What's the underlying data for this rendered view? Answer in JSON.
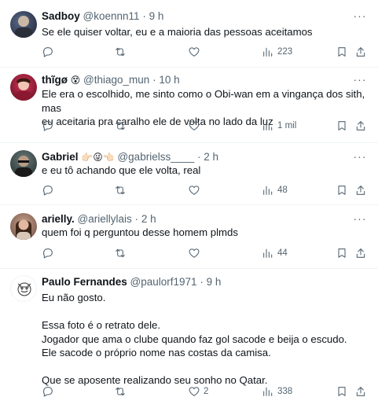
{
  "colors": {
    "text": "#0f1419",
    "secondary": "#536471",
    "divider": "#eff3f4"
  },
  "icons": {
    "reply": "reply-icon",
    "retweet": "retweet-icon",
    "like": "like-icon",
    "views": "views-icon",
    "bookmark": "bookmark-icon",
    "share": "share-icon",
    "more": "more-icon"
  },
  "tweets": [
    {
      "name": "Sadboy",
      "emoji": "",
      "handle": "@koennn11",
      "sep": "·",
      "time": "9 h",
      "lines": [
        "Se ele quiser voltar, eu e a maioria das pessoas aceitamos"
      ],
      "replies": "",
      "retweets": "",
      "likes": "",
      "views": "223"
    },
    {
      "name": "thĩgø",
      "emoji": "😵",
      "handle": "@thiago_mun",
      "sep": "·",
      "time": "10 h",
      "lines": [
        "Ele era o escolhido, me sinto como o Obi-wan em a vingança dos sith, mas",
        "eu aceitaria pra caralho ele de volta no lado da luz"
      ],
      "replies": "",
      "retweets": "",
      "likes": "",
      "views": "1 mil"
    },
    {
      "name": "Gabriel",
      "emoji": "👉🏻😜👈🏻",
      "handle": "@gabrielss____",
      "sep": "·",
      "time": "2 h",
      "lines": [
        "e eu tô achando que ele volta, real"
      ],
      "replies": "",
      "retweets": "",
      "likes": "",
      "views": "48"
    },
    {
      "name": "arielly.",
      "emoji": "",
      "handle": "@ariellylais",
      "sep": "·",
      "time": "2 h",
      "lines": [
        "quem foi q perguntou desse homem plmds"
      ],
      "replies": "",
      "retweets": "",
      "likes": "",
      "views": "44"
    },
    {
      "name": "Paulo Fernandes",
      "emoji": "",
      "handle": "@paulorf1971",
      "sep": "·",
      "time": "9 h",
      "lines": [
        "Eu não gosto.",
        "",
        "Essa foto é o retrato dele.",
        "Jogador que ama o clube quando faz gol sacode e beija o escudo.",
        "Ele sacode o próprio nome nas costas da camisa.",
        "",
        "Que se aposente realizando seu sonho no Qatar."
      ],
      "replies": "",
      "retweets": "",
      "likes": "2",
      "views": "338"
    }
  ]
}
